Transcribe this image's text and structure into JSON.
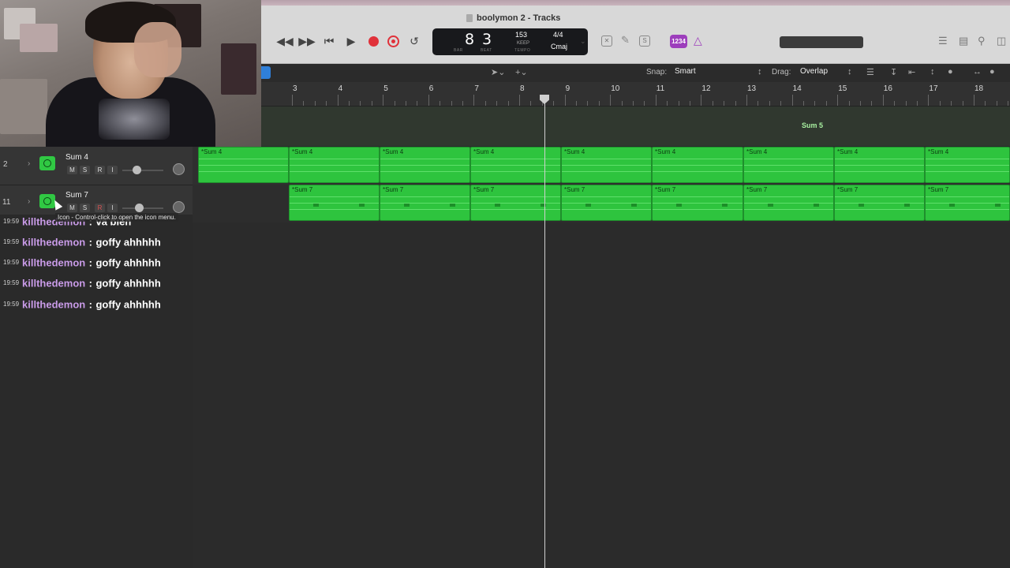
{
  "window": {
    "title": "boolymon 2 - Tracks"
  },
  "transport": {
    "lcd_bar": "8",
    "lcd_beat": "3",
    "lcd_bar_label": "BAR",
    "lcd_beat_label": "BEAT",
    "tempo": "153",
    "tempo_keep": "KEEP",
    "tempo_label": "TEMPO",
    "signature": "4/4",
    "key": "Cmaj",
    "count_in": "1234"
  },
  "tracks_bar": {
    "snap_label": "Snap:",
    "snap_value": "Smart",
    "drag_label": "Drag:",
    "drag_value": "Overlap"
  },
  "ruler": {
    "bars": [
      "3",
      "4",
      "5",
      "6",
      "7",
      "8",
      "9",
      "10",
      "11",
      "12",
      "13",
      "14",
      "15",
      "16",
      "17",
      "18"
    ]
  },
  "markers": {
    "top_region_label": "Sum 5"
  },
  "tracks": [
    {
      "number": "2",
      "name": "Sum 4",
      "region_label": "*Sum 4"
    },
    {
      "number": "11",
      "name": "Sum 7",
      "region_label": "*Sum 7"
    }
  ],
  "track_buttons": {
    "mute": "M",
    "solo": "S",
    "record": "R",
    "input": "I"
  },
  "tooltip": "Icon - Control-click to open the icon menu.",
  "chat": [
    {
      "time": "19:59",
      "user": "killthedemon",
      "sep": ":",
      "message": "va bien"
    },
    {
      "time": "19:59",
      "user": "killthedemon",
      "sep": ":",
      "message": "goffy ahhhhh"
    },
    {
      "time": "19:59",
      "user": "killthedemon",
      "sep": ":",
      "message": "goffy ahhhhh"
    },
    {
      "time": "19:59",
      "user": "killthedemon",
      "sep": ":",
      "message": "goffy ahhhhh"
    },
    {
      "time": "19:59",
      "user": "killthedemon",
      "sep": ":",
      "message": "goffy ahhhhh"
    }
  ],
  "colors": {
    "region_green": "#2ec43e",
    "record_red": "#e0313a",
    "count_in_purple": "#9d3ebc",
    "chat_username": "#c99be8"
  }
}
